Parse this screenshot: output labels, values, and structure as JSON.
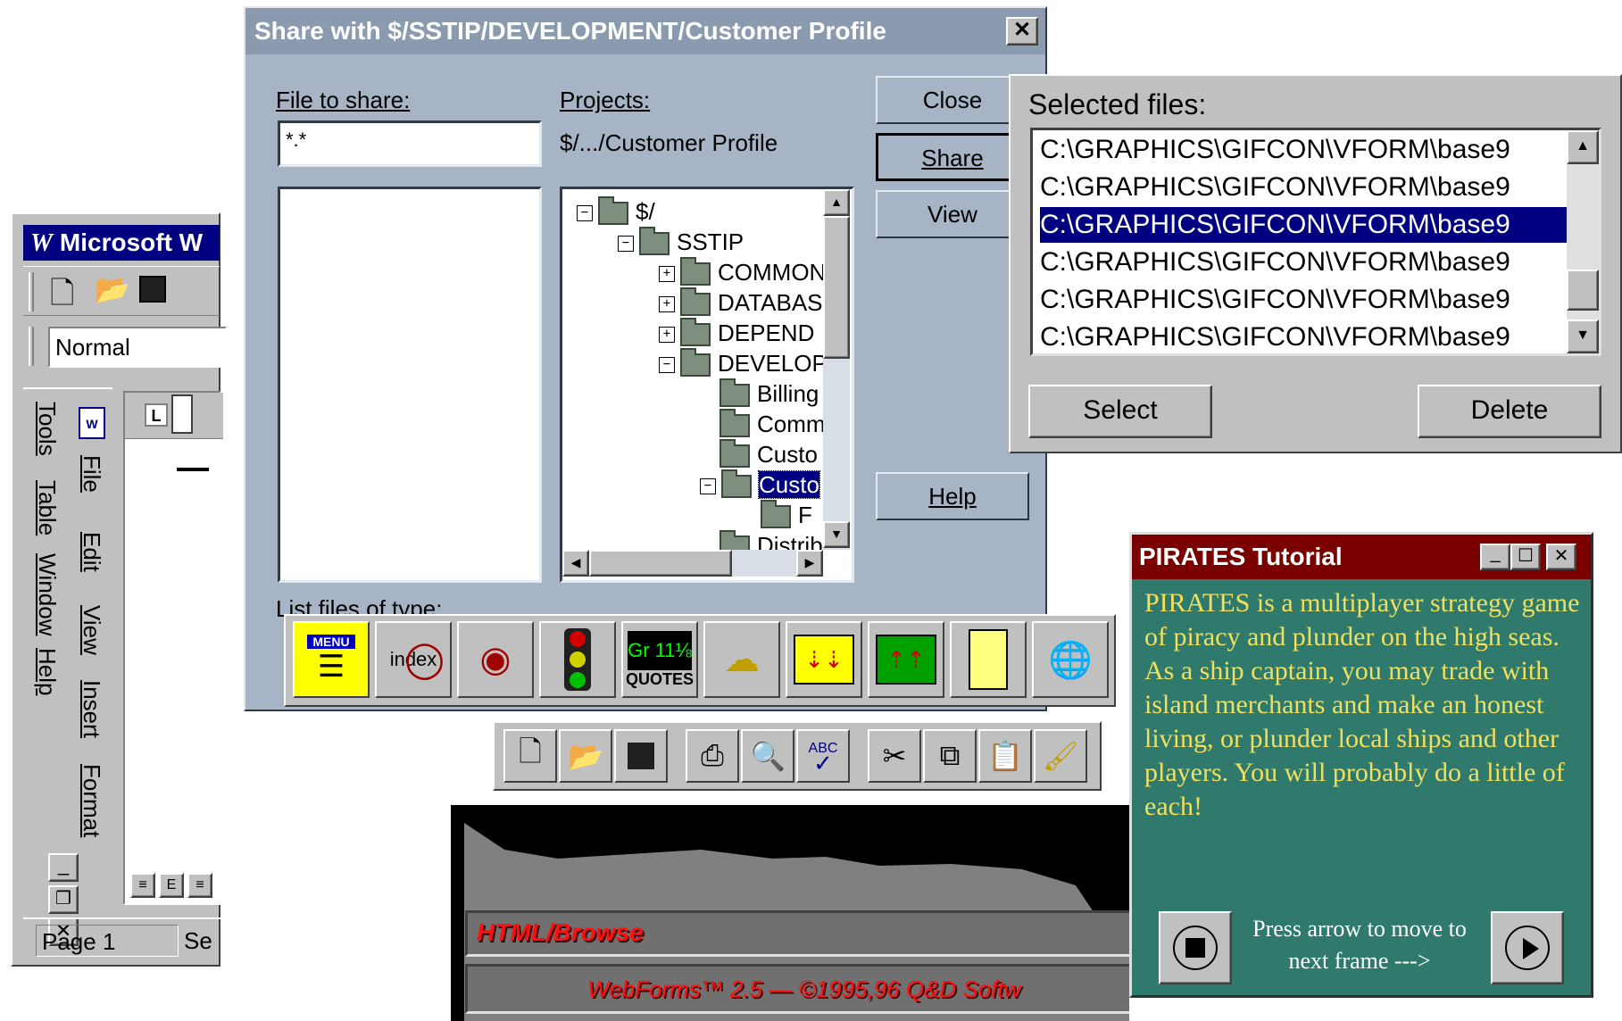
{
  "word": {
    "title": "Microsoft W",
    "style_value": "Normal",
    "menu": [
      "File",
      "Edit",
      "View",
      "Insert",
      "Format",
      "Tools",
      "Table",
      "Window",
      "Help"
    ],
    "status_page": "Page  1",
    "status_sec": "Se"
  },
  "share": {
    "title": "Share with $/SSTIP/DEVELOPMENT/Customer Profile",
    "file_label": "File to share:",
    "file_value": "*.*",
    "projects_label": "Projects:",
    "projects_path": "$/.../Customer Profile",
    "buttons": {
      "close": "Close",
      "share": "Share",
      "view": "View",
      "help": "Help"
    },
    "list_type_label": "List files of type:",
    "tree": [
      "$/",
      "SSTIP",
      "COMMON",
      "DATABAS",
      "DEPEND",
      "DEVELOP",
      "Billing",
      "Comm",
      "Custo",
      "Custo",
      "F",
      "Distrib"
    ]
  },
  "selected_files": {
    "label": "Selected files:",
    "files": [
      "C:\\GRAPHICS\\GIFCON\\VFORM\\base9",
      "C:\\GRAPHICS\\GIFCON\\VFORM\\base9",
      "C:\\GRAPHICS\\GIFCON\\VFORM\\base9",
      "C:\\GRAPHICS\\GIFCON\\VFORM\\base9",
      "C:\\GRAPHICS\\GIFCON\\VFORM\\base9",
      "C:\\GRAPHICS\\GIFCON\\VFORM\\base9"
    ],
    "selected_index": 2,
    "select_button": "Select",
    "delete_button": "Delete"
  },
  "icon_toolbar": {
    "menu_text": "MENU",
    "index_text": "index",
    "quotes_text": "QUOTES",
    "quotes_value": "Gr 11⅛",
    "icons": [
      "menu-list-icon",
      "index-magnifier-icon",
      "network-globe-icon",
      "traffic-light-icon",
      "stock-quotes-icon",
      "weather-icon",
      "inbox-down-icon",
      "outbox-up-icon",
      "file-cabinet-icon",
      "globe-orbit-icon"
    ]
  },
  "std_toolbar": {
    "icons": [
      "new-icon",
      "open-icon",
      "save-icon",
      "print-icon",
      "print-preview-icon",
      "spell-check-icon",
      "cut-icon",
      "copy-icon",
      "paste-icon",
      "format-painter-icon"
    ]
  },
  "webforms": {
    "browse": "HTML/Browse",
    "footer": "WebForms™  2.5 — ©1995,96 Q&D Softw"
  },
  "pirates": {
    "title": "PIRATES Tutorial",
    "body": "PIRATES is a multiplayer strategy game of piracy and plunder on the high seas.  As a ship captain, you may trade with island merchants and make an honest living, or plunder local ships and other players.  You will probably do a little of each!",
    "nav_text": "Press arrow to move to next frame --->"
  },
  "colors": {
    "dialog_bg": "#a6b4c6",
    "word_title": "#000080",
    "pirates_bg": "#2f7a6c",
    "pirates_title": "#7a0000",
    "pirates_text": "#f0e060",
    "webforms_text": "#ff1010"
  }
}
